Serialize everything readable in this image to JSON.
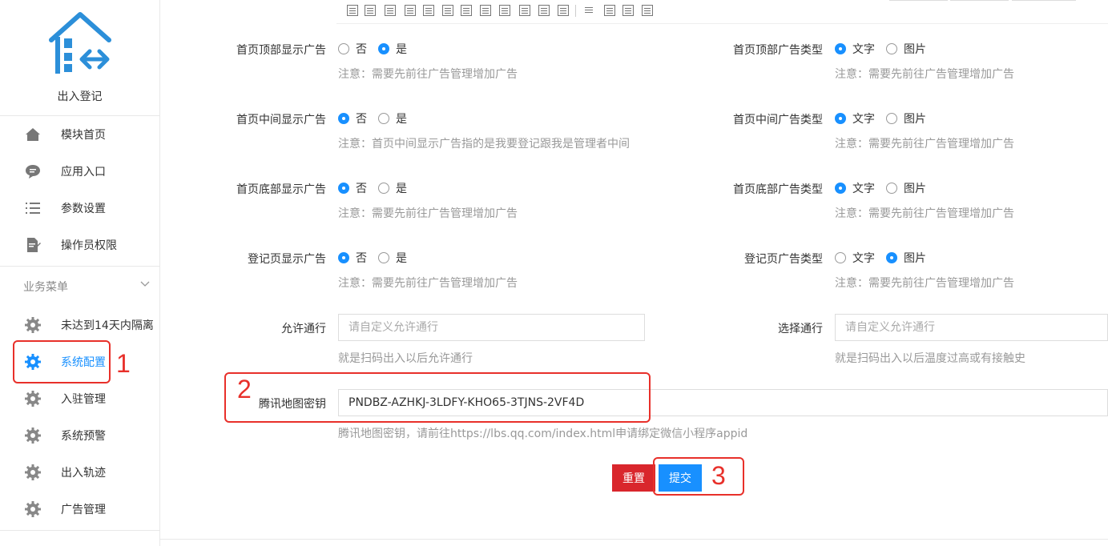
{
  "app": {
    "title": "出入登记"
  },
  "sidebar": {
    "items": [
      {
        "label": "模块首页",
        "icon": "home-icon"
      },
      {
        "label": "应用入口",
        "icon": "chat-icon"
      },
      {
        "label": "参数设置",
        "icon": "list-icon"
      },
      {
        "label": "操作员权限",
        "icon": "edit-doc-icon"
      }
    ],
    "group_title": "业务菜单",
    "business_items": [
      {
        "label": "未达到14天内隔离",
        "icon": "gear-icon"
      },
      {
        "label": "系统配置",
        "icon": "gear-icon",
        "active": true
      },
      {
        "label": "入驻管理",
        "icon": "gear-icon"
      },
      {
        "label": "系统预警",
        "icon": "gear-icon"
      },
      {
        "label": "出入轨迹",
        "icon": "gear-icon"
      },
      {
        "label": "广告管理",
        "icon": "gear-icon"
      }
    ]
  },
  "form": {
    "rows": [
      {
        "left": {
          "label": "首页顶部显示广告",
          "options": [
            "否",
            "是"
          ],
          "selected": "是",
          "hint": "注意：需要先前往广告管理增加广告"
        },
        "right": {
          "label": "首页顶部广告类型",
          "options": [
            "文字",
            "图片"
          ],
          "selected": "文字",
          "hint": "注意：需要先前往广告管理增加广告"
        }
      },
      {
        "left": {
          "label": "首页中间显示广告",
          "options": [
            "否",
            "是"
          ],
          "selected": "否",
          "hint": "注意：首页中间显示广告指的是我要登记跟我是管理者中间"
        },
        "right": {
          "label": "首页中间广告类型",
          "options": [
            "文字",
            "图片"
          ],
          "selected": "文字",
          "hint": "注意：需要先前往广告管理增加广告"
        }
      },
      {
        "left": {
          "label": "首页底部显示广告",
          "options": [
            "否",
            "是"
          ],
          "selected": "否",
          "hint": "注意：需要先前往广告管理增加广告"
        },
        "right": {
          "label": "首页底部广告类型",
          "options": [
            "文字",
            "图片"
          ],
          "selected": "文字",
          "hint": "注意：需要先前往广告管理增加广告"
        }
      },
      {
        "left": {
          "label": "登记页显示广告",
          "options": [
            "否",
            "是"
          ],
          "selected": "否",
          "hint": "注意：需要先前往广告管理增加广告"
        },
        "right": {
          "label": "登记页广告类型",
          "options": [
            "文字",
            "图片"
          ],
          "selected": "图片",
          "hint": "注意：需要先前往广告管理增加广告"
        }
      }
    ],
    "allow_pass": {
      "label": "允许通行",
      "placeholder": "请自定义允许通行",
      "value": "",
      "hint": "就是扫码出入以后允许通行"
    },
    "select_pass": {
      "label": "选择通行",
      "placeholder": "请自定义允许通行",
      "value": "",
      "hint": "就是扫码出入以后温度过高或有接触史"
    },
    "map_key": {
      "label": "腾讯地图密钥",
      "value": "PNDBZ-AZHKJ-3LDFY-KHO65-3TJNS-2VF4D",
      "hint": "腾讯地图密钥，请前往https://lbs.qq.com/index.html申请绑定微信小程序appid"
    },
    "reset_label": "重置",
    "submit_label": "提交"
  },
  "annotations": [
    "1",
    "2",
    "3"
  ],
  "colors": {
    "accent": "#1890ff",
    "danger": "#d9262c",
    "annotation": "#e8302a"
  }
}
